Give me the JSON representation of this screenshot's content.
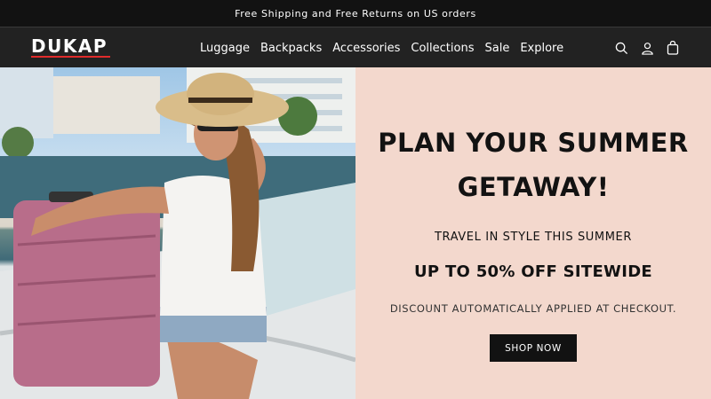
{
  "announcement": "Free Shipping and Free Returns on US orders",
  "header": {
    "logo": "DUKAP",
    "nav": [
      "Luggage",
      "Backpacks",
      "Accessories",
      "Collections",
      "Sale",
      "Explore"
    ],
    "icons": [
      "search-icon",
      "account-icon",
      "cart-icon"
    ]
  },
  "hero": {
    "image_description": "Woman in sun hat and sunglasses sitting on a boat beside a pink hard-shell suitcase",
    "title": "PLAN YOUR SUMMER GETAWAY!",
    "subtitle": "TRAVEL IN STYLE THIS SUMMER",
    "offer": "UP TO 50% OFF SITEWIDE",
    "note": "DISCOUNT AUTOMATICALLY APPLIED AT CHECKOUT.",
    "cta": "SHOP NOW"
  },
  "colors": {
    "announcement_bg": "#121212",
    "header_bg": "#222222",
    "logo_accent": "#e02b2b",
    "hero_panel_bg": "#f3d8cd",
    "button_bg": "#121212"
  }
}
